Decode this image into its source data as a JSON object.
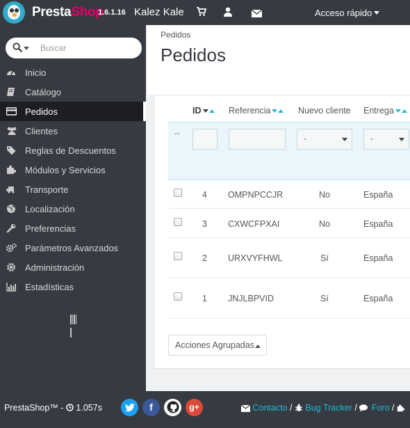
{
  "header": {
    "brand_part1": "Presta",
    "brand_part2": "Shop",
    "version": "1.6.1.16",
    "shop_name": "Kalez Kale",
    "quick_access": "Acceso rápido"
  },
  "sidebar": {
    "search_placeholder": "Buscar",
    "items": [
      {
        "label": "Inicio",
        "icon": "dashboard-icon"
      },
      {
        "label": "Catálogo",
        "icon": "book-icon"
      },
      {
        "label": "Pedidos",
        "icon": "credit-card-icon",
        "active": true
      },
      {
        "label": "Clientes",
        "icon": "users-icon"
      },
      {
        "label": "Reglas de Descuentos",
        "icon": "tags-icon"
      },
      {
        "label": "Módulos y Servicios",
        "icon": "puzzle-icon"
      },
      {
        "label": "Transporte",
        "icon": "truck-icon"
      },
      {
        "label": "Localización",
        "icon": "globe-icon"
      },
      {
        "label": "Preferencias",
        "icon": "wrench-icon"
      },
      {
        "label": "Parámetros Avanzados",
        "icon": "cogs-icon"
      },
      {
        "label": "Administración",
        "icon": "cog-icon"
      },
      {
        "label": "Estadísticas",
        "icon": "bar-chart-icon"
      }
    ]
  },
  "main": {
    "breadcrumb": "Pedidos",
    "title": "Pedidos",
    "columns": {
      "id": "ID",
      "reference": "Referencia",
      "new_client": "Nuevo cliente",
      "delivery": "Entrega"
    },
    "filters": {
      "dash": "--",
      "new_client_select": "-",
      "delivery_select": "-"
    },
    "rows": [
      {
        "id": "4",
        "reference": "OMPNPCCJR",
        "new_client": "No",
        "delivery": "España"
      },
      {
        "id": "3",
        "reference": "CXWCFPXAI",
        "new_client": "No",
        "delivery": "España"
      },
      {
        "id": "2",
        "reference": "URXVYFHWL",
        "new_client": "Sí",
        "delivery": "España"
      },
      {
        "id": "1",
        "reference": "JNJLBPVID",
        "new_client": "Sí",
        "delivery": "España"
      }
    ],
    "bulk_actions": "Acciones Agrupadas"
  },
  "footer": {
    "brand": "PrestaShop™",
    "separator": " - ",
    "load_time": "1.057s",
    "social": {
      "twitter": "twitter-icon",
      "facebook": "facebook-icon",
      "github": "github-icon",
      "google_plus": "google-plus-icon"
    },
    "links": {
      "contact": "Contacto",
      "bug_tracker": "Bug Tracker",
      "forum": "Foro",
      "sep": "/"
    }
  },
  "colors": {
    "dark_bg": "#363a41",
    "accent": "#25b9d7",
    "brand_pink": "#df0067",
    "twitter": "#1da1f2",
    "facebook": "#3b5998",
    "google_plus": "#dd4b39"
  }
}
